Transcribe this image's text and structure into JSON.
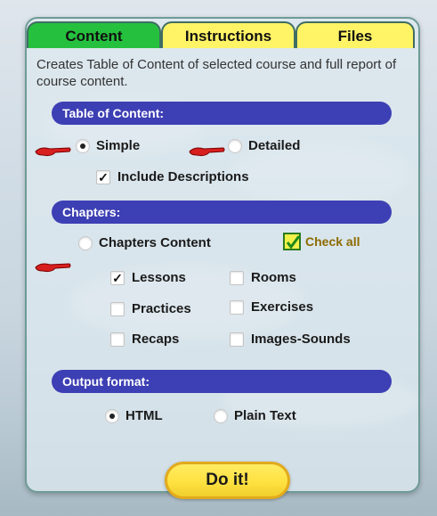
{
  "tabs": [
    {
      "label": "Content",
      "color": "#25c13e",
      "active": true
    },
    {
      "label": "Instructions",
      "color": "#fff466",
      "active": false
    },
    {
      "label": "Files",
      "color": "#fff466",
      "active": false
    }
  ],
  "description": "Creates Table of Content of selected course and full report of course content.",
  "toc": {
    "header": "Table of Content:",
    "simple_label": "Simple",
    "detailed_label": "Detailed",
    "include_desc_label": "Include Descriptions",
    "selected": "Simple",
    "include_desc_checked": true
  },
  "chapters": {
    "header": "Chapters:",
    "content_label": "Chapters Content",
    "check_all_label": "Check all",
    "check_all_checked": true,
    "items": [
      {
        "label": "Lessons",
        "checked": true
      },
      {
        "label": "Rooms",
        "checked": false
      },
      {
        "label": "Practices",
        "checked": false
      },
      {
        "label": "Exercises",
        "checked": false
      },
      {
        "label": "Recaps",
        "checked": false
      },
      {
        "label": "Images-Sounds",
        "checked": false
      }
    ]
  },
  "output": {
    "header": "Output format:",
    "html_label": "HTML",
    "text_label": "Plain Text",
    "selected": "HTML"
  },
  "doit_label": "Do it!",
  "colors": {
    "section_bar": "#3d3fb4",
    "doit_button": "#ffe141",
    "pointer": "#d81f1f"
  }
}
